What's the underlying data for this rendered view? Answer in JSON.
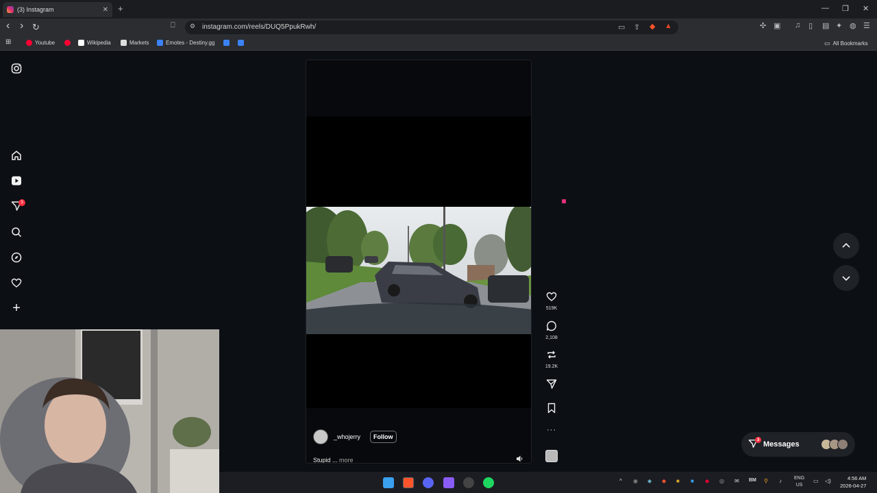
{
  "browser": {
    "tab_title": "(3) Instagram",
    "tab_close": "✕",
    "new_tab": "+",
    "url": "instagram.com/reels/DUQ5PpukRwh/",
    "window_controls": [
      "—",
      "❐",
      "✕"
    ],
    "nav": {
      "back": "‹",
      "forward": "›",
      "reload": "↻"
    }
  },
  "bookmarks": {
    "items": [
      {
        "label": "Youtube",
        "color": "#ff0033"
      },
      {
        "label": "",
        "color": "#ff0033"
      },
      {
        "label": "Wikipedia",
        "color": "#ffffff"
      },
      {
        "label": "Markets",
        "color": "#ffffff"
      },
      {
        "label": "Emotes - Destiny.gg",
        "color": "#3b82f6"
      },
      {
        "label": "",
        "color": "#3b82f6"
      },
      {
        "label": "",
        "color": "#3b82f6"
      }
    ],
    "all_bookmarks": "All Bookmarks"
  },
  "sidebar": {
    "items": [
      {
        "name": "instagram-logo-icon",
        "glyph": "◎"
      },
      {
        "name": "home-icon",
        "glyph": "⌂"
      },
      {
        "name": "reels-icon",
        "glyph": "▶"
      },
      {
        "name": "notifications-icon",
        "glyph": "▽"
      },
      {
        "name": "search-icon",
        "glyph": "⚲"
      },
      {
        "name": "explore-icon",
        "glyph": "◉"
      },
      {
        "name": "heart-icon",
        "glyph": "♡"
      },
      {
        "name": "create-icon",
        "glyph": "+"
      }
    ],
    "notif_badge": "3"
  },
  "reel": {
    "username": "_whojerry",
    "follow_label": "Follow",
    "caption": "Stupid",
    "caption_ellipsis": " ... ",
    "more_label": "more",
    "mute_glyph": "🔈"
  },
  "actions": {
    "like": {
      "glyph": "♡",
      "count": "519K"
    },
    "comment": {
      "glyph": "◯",
      "count": "2,108"
    },
    "repost": {
      "glyph": "⟲",
      "count": "19.2K"
    },
    "share": {
      "glyph": "▽"
    },
    "save": {
      "glyph": "⊓"
    },
    "more": {
      "glyph": "···"
    }
  },
  "reel_nav": {
    "up": "︿",
    "down": "﹀"
  },
  "messages": {
    "label": "Messages",
    "badge": "3"
  },
  "taskbar": {
    "lang_top": "ENG",
    "lang_bottom": "US",
    "time": "4:56 AM",
    "date": "2026-04-27"
  }
}
